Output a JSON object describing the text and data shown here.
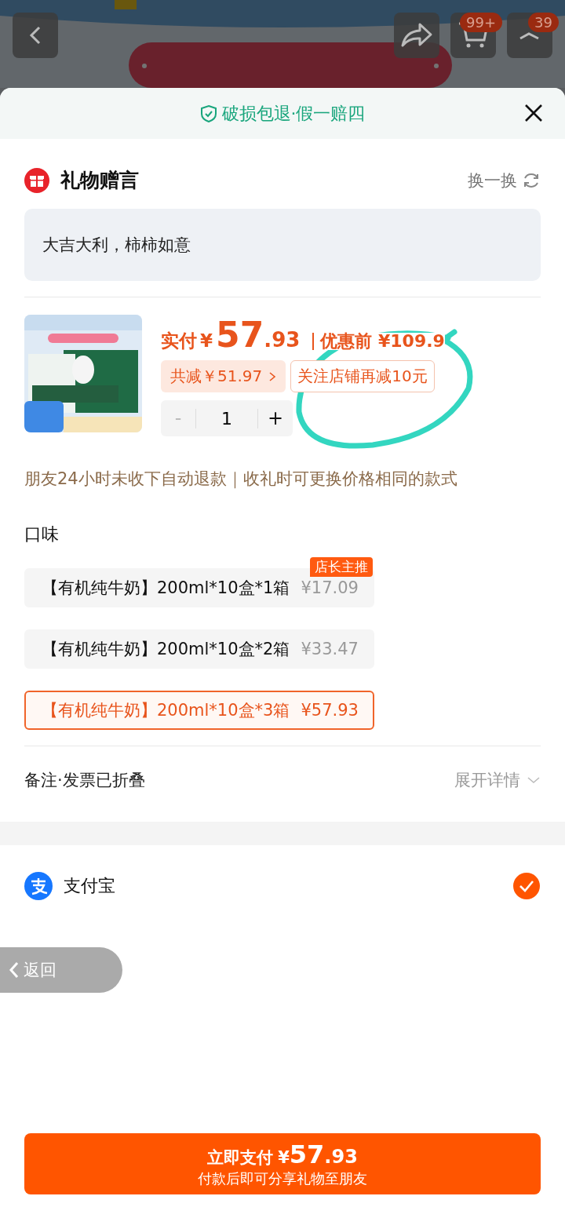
{
  "top_bar": {
    "badges": [
      {
        "text": "99+"
      },
      {
        "text": "39"
      }
    ]
  },
  "sheet": {
    "guarantee": "破损包退·假一赔四"
  },
  "gift": {
    "title": "礼物赠言",
    "refresh": "换一换",
    "message": "大吉大利，柿柿如意"
  },
  "product": {
    "paid_label": "实付",
    "currency": "¥",
    "price_int": "57",
    "price_dec": ".93",
    "before": "优惠前 ¥109.9",
    "discount": "共减￥51.97",
    "follow_coupon": "关注店铺再减10元",
    "quantity": "1",
    "minus": "-",
    "plus": "+"
  },
  "notice": "朋友24小时未收下自动退款｜收礼时可更换价格相同的款式",
  "flavor": {
    "title": "口味",
    "options": [
      {
        "name": "【有机纯牛奶】200ml*10盒*1箱",
        "price": "¥17.09",
        "selected": false,
        "tag": "店长主推"
      },
      {
        "name": "【有机纯牛奶】200ml*10盒*2箱",
        "price": "¥33.47",
        "selected": false
      },
      {
        "name": "【有机纯牛奶】200ml*10盒*3箱",
        "price": "¥57.93",
        "selected": true
      }
    ]
  },
  "notes": {
    "label": "备注·发票已折叠",
    "expand": "展开详情"
  },
  "payment": {
    "method": "支付宝",
    "checked": true
  },
  "back_button": "返回",
  "pay_button": {
    "label": "立即支付",
    "currency": "¥",
    "price_int": "57",
    "price_dec": ".93",
    "subtitle": "付款后即可分享礼物至朋友"
  }
}
